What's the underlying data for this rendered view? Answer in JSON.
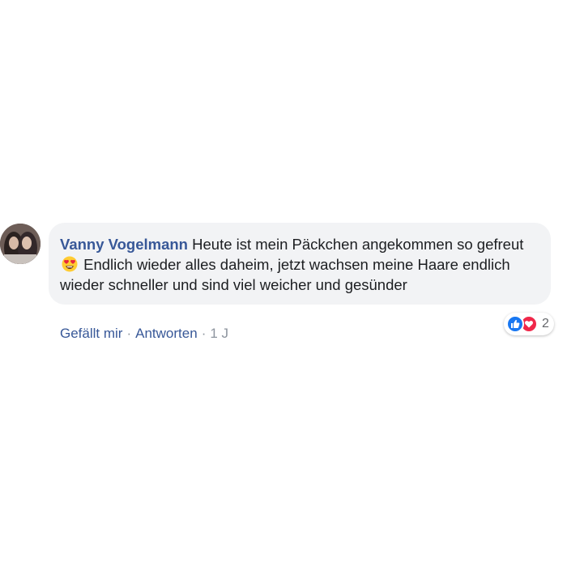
{
  "comment": {
    "author": "Vanny Vogelmann",
    "text_before_emoji": "Heute ist mein Päckchen angekommen so gefreut",
    "emoji_icon": "heart-eyes-emoji-icon",
    "text_after_emoji": "Endlich wieder alles daheim, jetzt wachsen meine Haare endlich wieder schneller und sind viel weicher und gesünder",
    "actions": {
      "like_label": "Gefällt mir",
      "separator": "·",
      "reply_label": "Antworten",
      "time": "1 J"
    },
    "reactions": {
      "icons": [
        "like-icon",
        "love-icon"
      ],
      "count": "2",
      "colors": {
        "like": "#1877f2",
        "love": "#f0284a"
      }
    }
  },
  "colors": {
    "author": "#385898",
    "bubble": "#f2f3f5",
    "text": "#1c1e21",
    "meta": "#8d949e"
  }
}
